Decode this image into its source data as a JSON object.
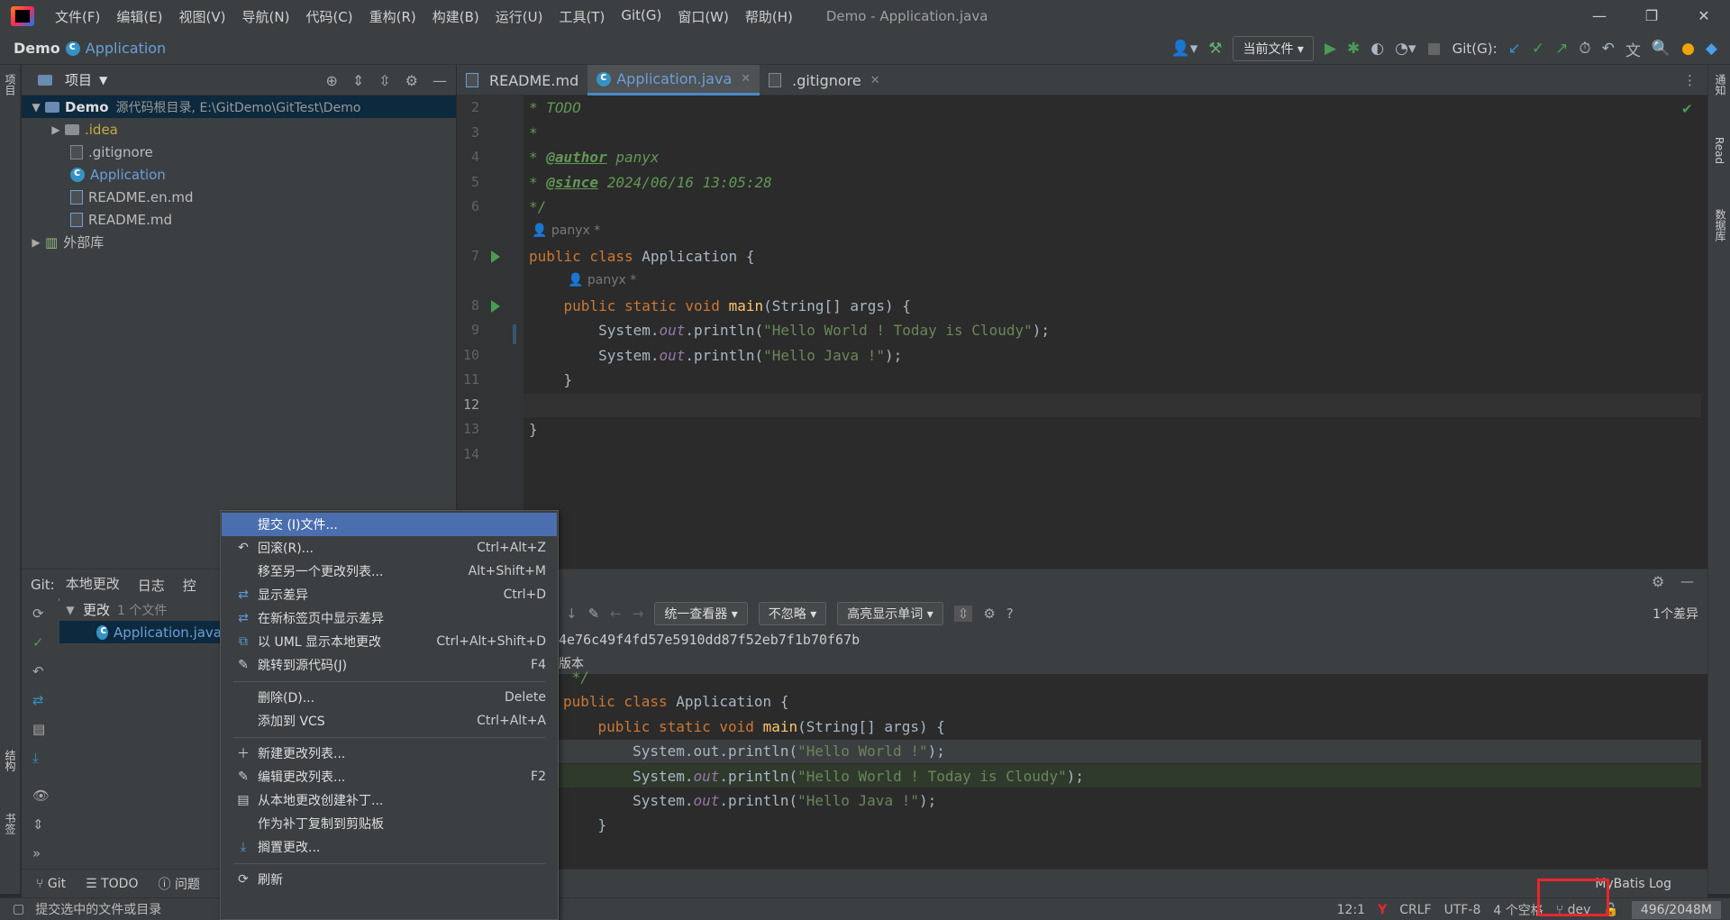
{
  "titlebar": {
    "menus": [
      "文件(F)",
      "编辑(E)",
      "视图(V)",
      "导航(N)",
      "代码(C)",
      "重构(R)",
      "构建(B)",
      "运行(U)",
      "工具(T)",
      "Git(G)",
      "窗口(W)",
      "帮助(H)"
    ],
    "window_title": "Demo - Application.java"
  },
  "navbar": {
    "project": "Demo",
    "file": "Application",
    "run_config": "当前文件",
    "git_label": "Git(G):"
  },
  "left_strip": {
    "project": "项目",
    "structure": "结构",
    "bookmarks": "书签"
  },
  "right_strip": {
    "notifications": "通知",
    "read": "Read",
    "database": "数据库"
  },
  "project_panel": {
    "title": "项目",
    "root": "Demo",
    "root_path": "源代码根目录, E:\\GitDemo\\GitTest\\Demo",
    "items": [
      ".idea",
      ".gitignore",
      "Application",
      "README.en.md",
      "README.md"
    ],
    "external": "外部库"
  },
  "editor": {
    "tabs": [
      "README.md",
      "Application.java",
      ".gitignore"
    ],
    "line_numbers": [
      "2",
      "3",
      "4",
      "5",
      "6",
      "7",
      "8",
      "9",
      "10",
      "11",
      "12",
      "13",
      "14"
    ],
    "author_hint": "panyx *",
    "author_name": "panyx",
    "since_date": "2024/06/16 13:05:28",
    "todo": "* TODO",
    "author_tag": "@author",
    "since_tag": "@since",
    "str1": "\"Hello World ! Today is Cloudy\"",
    "str2": "\"Hello Java !\""
  },
  "git_panel": {
    "label": "Git:",
    "tabs": [
      "本地更改",
      "日志",
      "控"
    ],
    "group": "更改",
    "group_count": "1 个文件",
    "file": "Application.java",
    "diff": {
      "viewer": "统一查看器",
      "ignore": "不忽略",
      "highlight": "高亮显示单词",
      "count": "1个差异",
      "hash": "4e76c49f4fd57e5910dd87f52eb7f1b70f67b",
      "version": "版本"
    }
  },
  "context_menu": {
    "items": [
      {
        "label": "提交 (I)文件...",
        "shortcut": ""
      },
      {
        "label": "回滚(R)...",
        "shortcut": "Ctrl+Alt+Z"
      },
      {
        "label": "移至另一个更改列表...",
        "shortcut": "Alt+Shift+M"
      },
      {
        "label": "显示差异",
        "shortcut": "Ctrl+D"
      },
      {
        "label": "在新标签页中显示差异",
        "shortcut": ""
      },
      {
        "label": "以 UML 显示本地更改",
        "shortcut": "Ctrl+Alt+Shift+D"
      },
      {
        "label": "跳转到源代码(J)",
        "shortcut": "F4"
      },
      {
        "label": "删除(D)...",
        "shortcut": "Delete"
      },
      {
        "label": "添加到 VCS",
        "shortcut": "Ctrl+Alt+A"
      },
      {
        "label": "新建更改列表...",
        "shortcut": ""
      },
      {
        "label": "编辑更改列表...",
        "shortcut": "F2"
      },
      {
        "label": "从本地更改创建补丁...",
        "shortcut": ""
      },
      {
        "label": "作为补丁复制到剪贴板",
        "shortcut": ""
      },
      {
        "label": "搁置更改...",
        "shortcut": ""
      },
      {
        "label": "刷新",
        "shortcut": ""
      }
    ]
  },
  "bottom_tools": {
    "git": "Git",
    "todo": "TODO",
    "problems": "问题",
    "mybatis": "MyBatis Log"
  },
  "statusbar": {
    "message": "提交选中的文件或目录",
    "position": "12:1",
    "line_sep": "CRLF",
    "encoding": "UTF-8",
    "indent": "4 个空格",
    "branch": "dev",
    "memory": "496/2048M"
  },
  "colors": {
    "accent": "#4b6eaf",
    "highlight_box": "#e8262c",
    "keyword": "#cc7832",
    "string": "#6a8759"
  }
}
